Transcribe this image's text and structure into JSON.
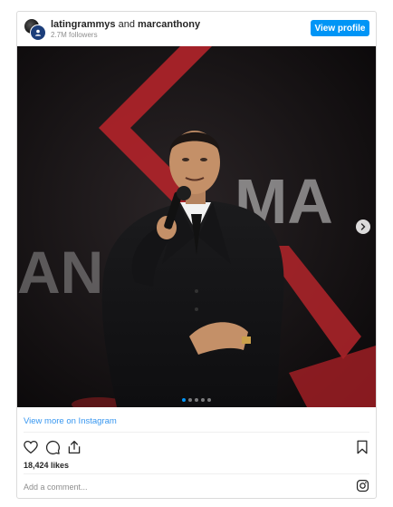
{
  "header": {
    "account_primary": "latingrammys",
    "account_joiner": " and ",
    "account_secondary": "marcanthony",
    "followers": "2.7M followers",
    "view_profile_label": "View profile"
  },
  "media": {
    "backdrop_letters_top": "MA",
    "backdrop_letters_bottom": "AN  HO",
    "slide_count": 5,
    "active_slide": 1
  },
  "footer": {
    "view_more_label": "View more on Instagram",
    "likes": "18,424 likes",
    "comment_placeholder": "Add a comment..."
  },
  "colors": {
    "accent": "#0095f6",
    "stage_red": "#c8262b",
    "link": "#3897f0"
  },
  "icons": [
    "heart-icon",
    "comment-icon",
    "share-icon",
    "bookmark-icon",
    "instagram-icon",
    "chevron-right-icon"
  ]
}
